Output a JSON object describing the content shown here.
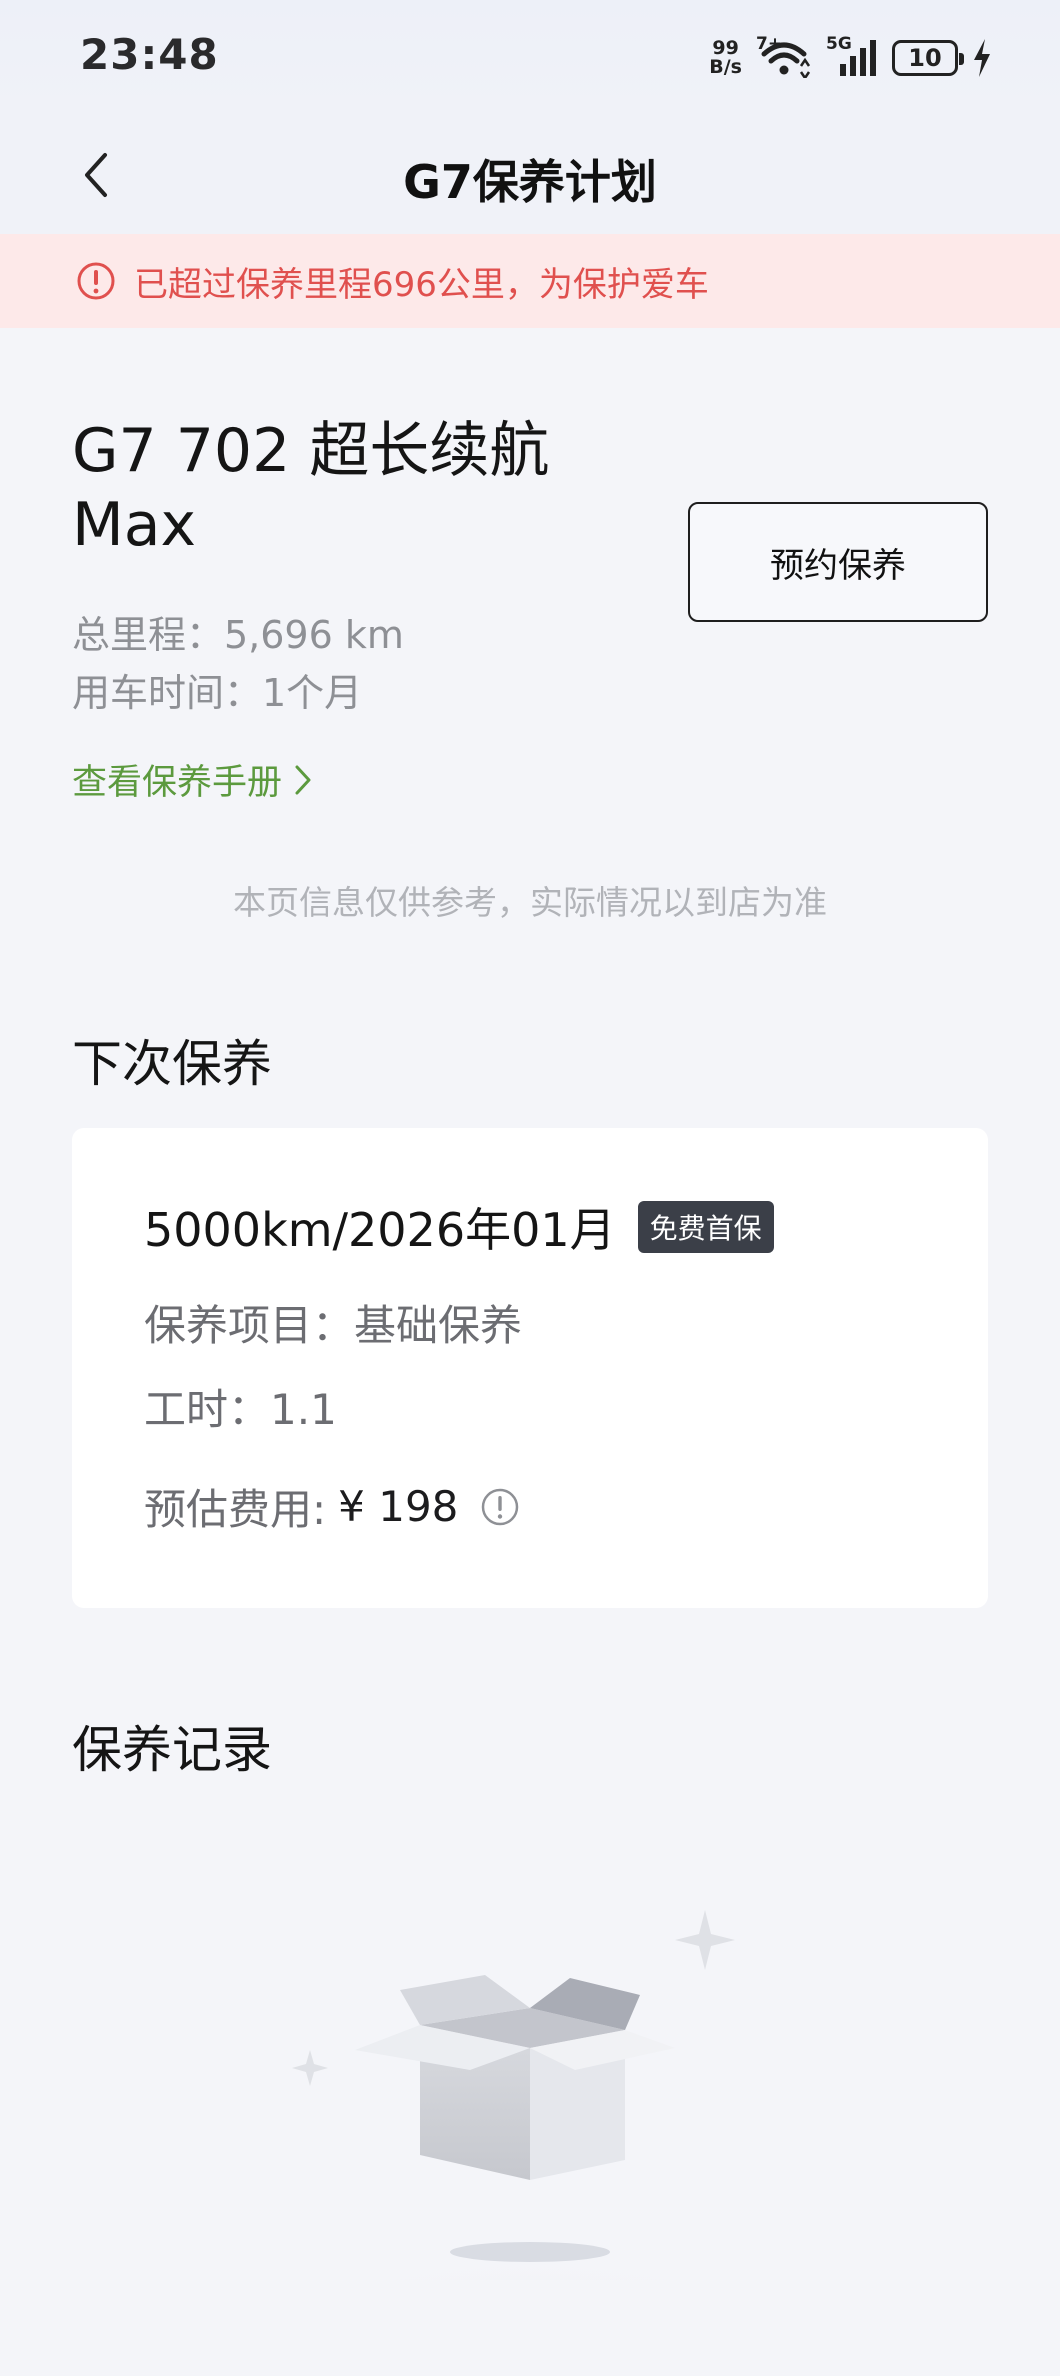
{
  "status_bar": {
    "time": "23:48",
    "net_speed_value": "99",
    "net_speed_unit": "B/s",
    "wifi_label": "7+",
    "signal_label": "5G",
    "battery": "10",
    "icons": [
      "wifi-icon",
      "signal-icon",
      "battery-icon",
      "charging-icon"
    ]
  },
  "header": {
    "title": "G7保养计划",
    "back_icon": "chevron-left-icon"
  },
  "warning": {
    "text": "已超过保养里程696公里，为保护爱车",
    "icon": "info-circle-icon",
    "color": "#e0504e",
    "background": "#fde9e9"
  },
  "vehicle": {
    "name_line1": "G7 702 超长续航",
    "name_line2": "Max",
    "mileage": "总里程：5,696 km",
    "usage_time": "用车时间：1个月",
    "book_button": "预约保养",
    "manual_link": "查看保养手册",
    "manual_link_color": "#5c9a3e"
  },
  "disclaimer": "本页信息仅供参考，实际情况以到店为准",
  "next_maintenance": {
    "section_title": "下次保养",
    "plan": "5000km/2026年01月",
    "badge": "免费首保",
    "items": "保养项目：基础保养",
    "labor_hours": "工时：1.1",
    "cost_label": "预估费用:",
    "cost_value": "¥ 198"
  },
  "records": {
    "section_title": "保养记录",
    "empty_illustration": "empty-box-illustration"
  }
}
